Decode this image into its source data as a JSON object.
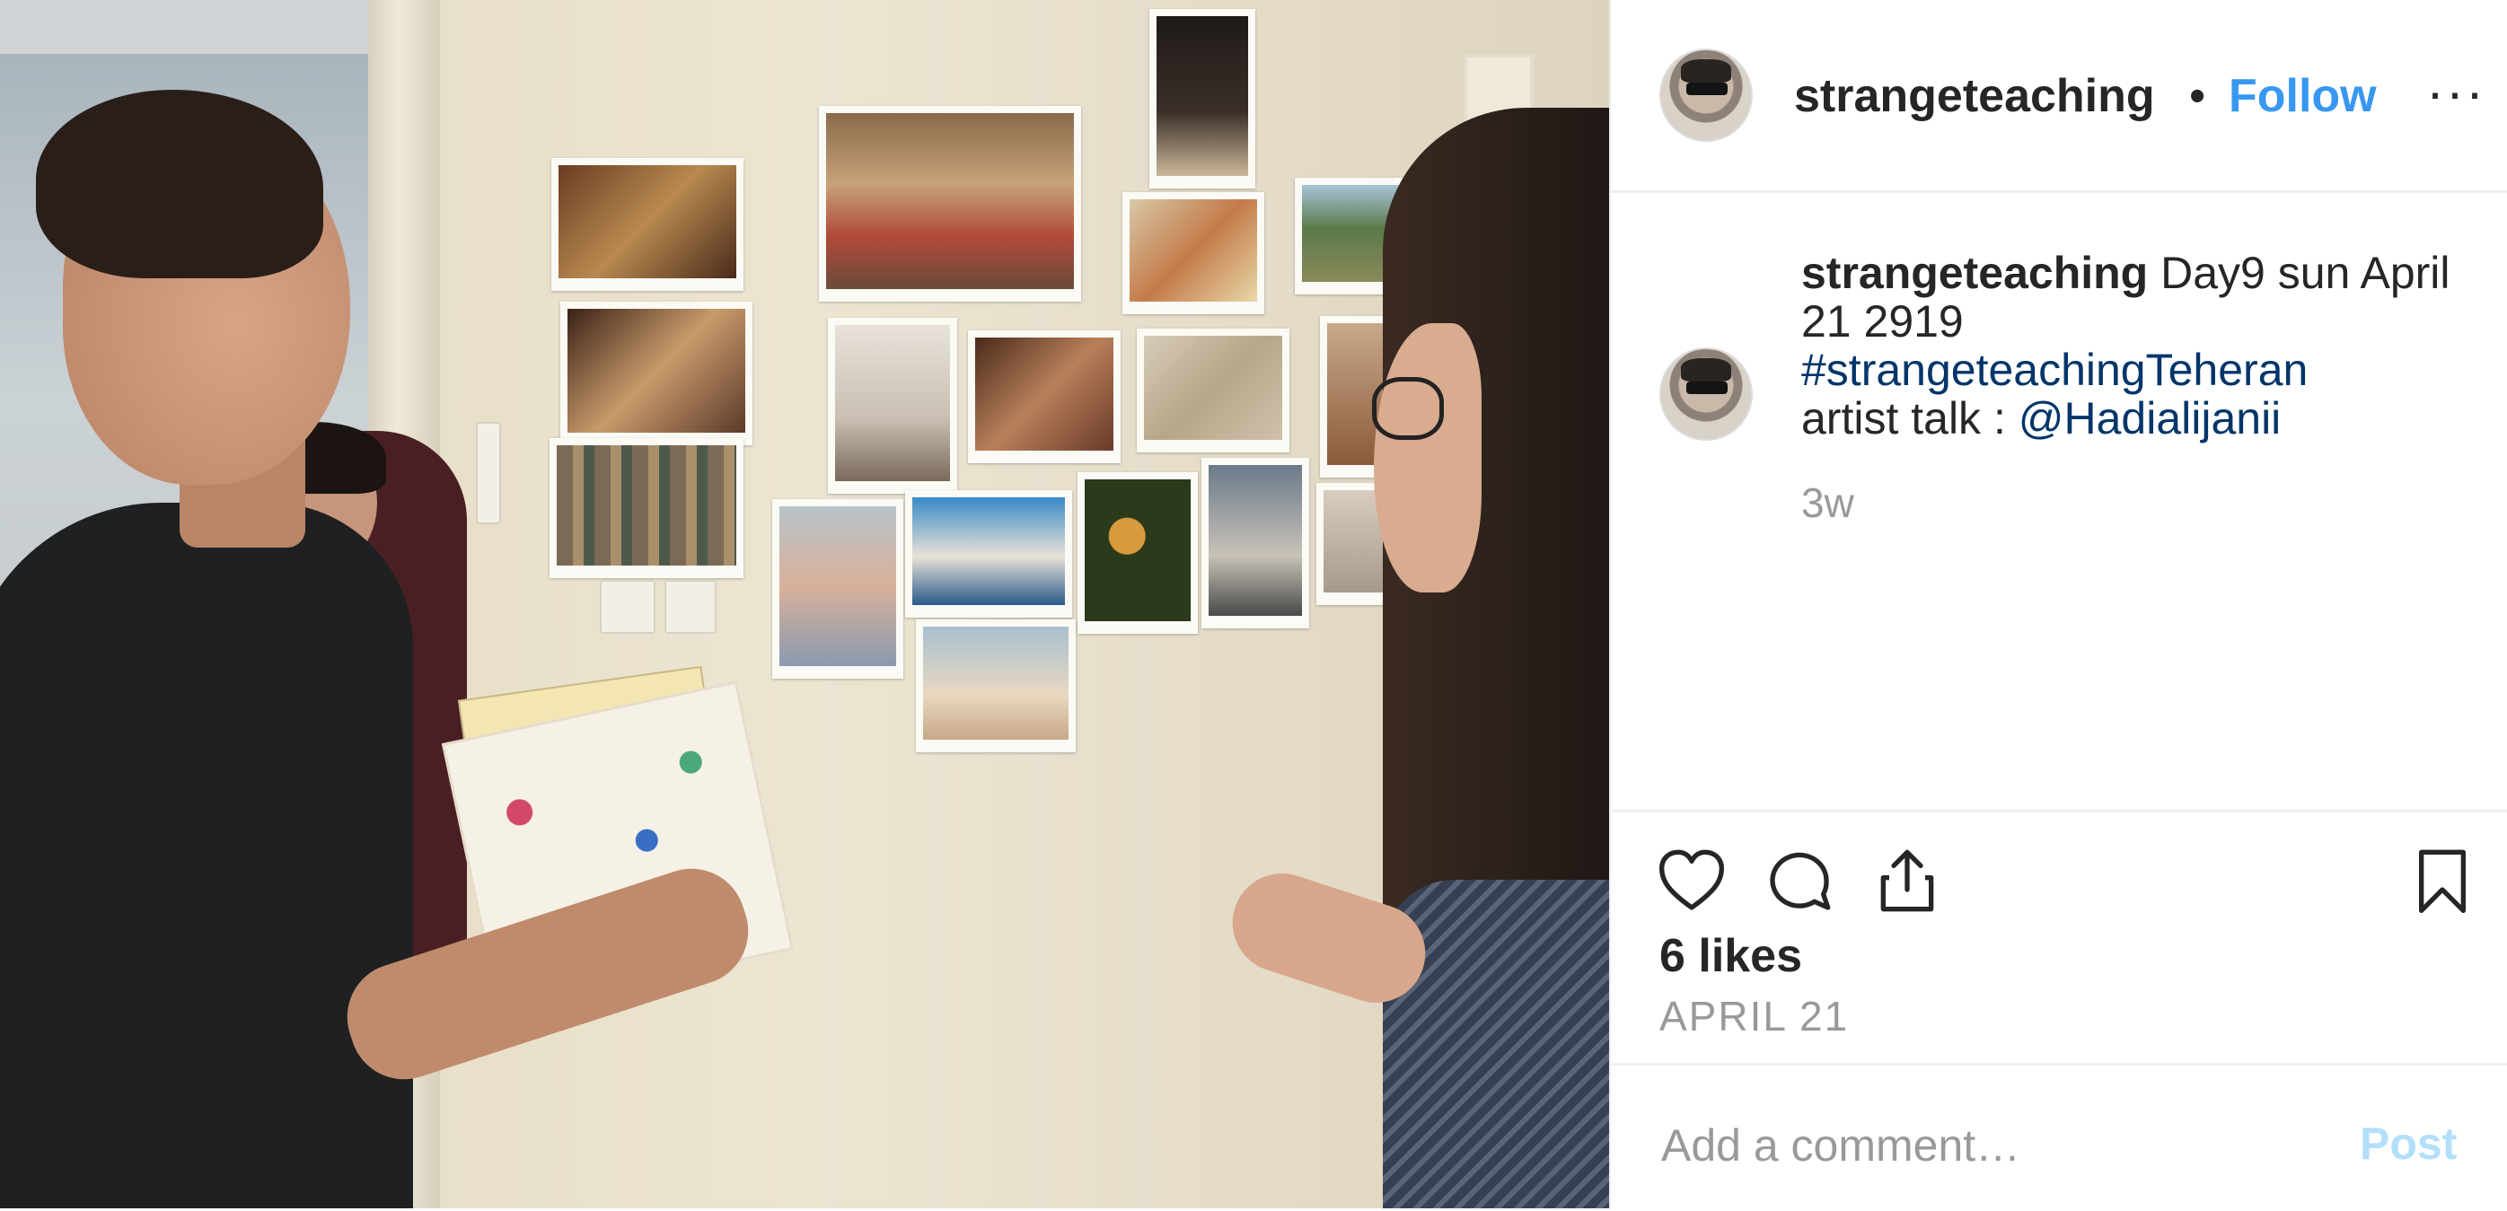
{
  "post": {
    "header": {
      "username": "strangeteaching",
      "separator": "•",
      "follow_label": "Follow",
      "more_icon": "ellipsis-icon",
      "more_label": "···"
    },
    "caption": {
      "username": "strangeteaching",
      "line1": " Day9 sun April 21 2919",
      "hashtag": "#strangeteachingTeheran",
      "line3_prefix": "artist talk : ",
      "mention": "@Hadialijanii",
      "time_ago": "3w"
    },
    "actions": {
      "like_icon": "heart-icon",
      "comment_icon": "comment-icon",
      "share_icon": "share-icon",
      "save_icon": "bookmark-icon"
    },
    "likes_text": "6 likes",
    "date_text": "APRIL 21",
    "comment_box": {
      "placeholder": "Add a comment…",
      "post_label": "Post"
    },
    "colors": {
      "link_blue": "#3897f0",
      "caption_link": "#003569",
      "muted": "#999999",
      "post_disabled": "#b2dffc",
      "text": "#262626"
    }
  }
}
